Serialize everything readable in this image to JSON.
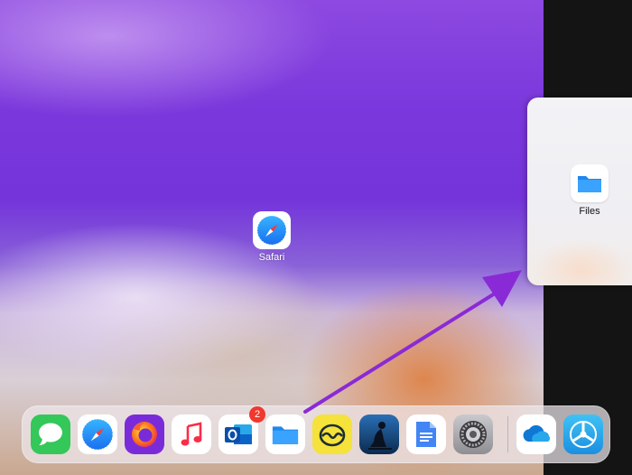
{
  "home_screen": {
    "apps": [
      {
        "name": "Safari",
        "icon": "safari-compass-icon"
      }
    ]
  },
  "slide_over": {
    "app": {
      "name": "Files",
      "icon": "folder-icon"
    }
  },
  "dock": {
    "apps": [
      {
        "id": "messages",
        "icon": "speech-bubble-icon",
        "color": "#34c759"
      },
      {
        "id": "safari",
        "icon": "safari-compass-icon",
        "color": "#1e90ff"
      },
      {
        "id": "firefox",
        "icon": "firefox-icon",
        "color": "#7a2bd9"
      },
      {
        "id": "music",
        "icon": "music-note-icon",
        "color": "#fa2d48"
      },
      {
        "id": "outlook",
        "icon": "outlook-icon",
        "color": "#0a64c8",
        "badge": "2"
      },
      {
        "id": "files",
        "icon": "folder-icon",
        "color": "#1c8ef0"
      },
      {
        "id": "basecamp",
        "icon": "basecamp-icon",
        "color": "#f5e23a"
      },
      {
        "id": "kindle",
        "icon": "kindle-reader-icon",
        "color": "#1a4c80"
      },
      {
        "id": "docs",
        "icon": "document-icon",
        "color": "#4285f4"
      },
      {
        "id": "settings",
        "icon": "gear-icon",
        "color": "#8e8e93"
      },
      {
        "id": "onedrive",
        "icon": "cloud-icon",
        "color": "#0f78d4"
      },
      {
        "id": "testflight",
        "icon": "propeller-icon",
        "color": "#25a7ea"
      }
    ]
  },
  "gesture": {
    "icon": "drag-arrow-icon",
    "color": "#8a2ad6"
  }
}
